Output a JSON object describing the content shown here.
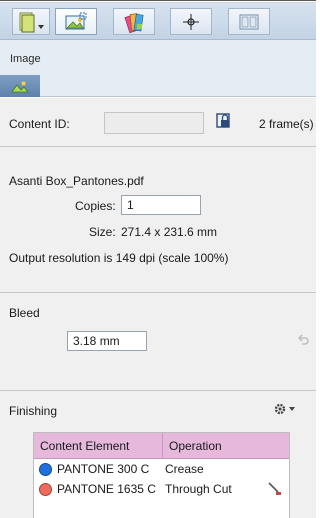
{
  "toolbar": {
    "items": [
      {
        "name": "document-dropdown",
        "icon": "document-dropdown-icon"
      },
      {
        "name": "image",
        "icon": "image-icon"
      },
      {
        "name": "color-swatches",
        "icon": "color-swatches-icon"
      },
      {
        "name": "marks",
        "icon": "crosshair-icon"
      },
      {
        "name": "layout",
        "icon": "layout-icon"
      }
    ],
    "active": "image"
  },
  "tab": {
    "label": "Image",
    "icon": "image-icon"
  },
  "content": {
    "label": "Content ID:",
    "id_value": "",
    "frames": "2 frame(s)",
    "lock_icon": "frame-lock-icon"
  },
  "file": {
    "name": "Asanti Box_Pantones.pdf",
    "copies_label": "Copies:",
    "copies_value": "1",
    "size_label": "Size:",
    "size_value": "271.4 x 231.6 mm",
    "resolution": "Output resolution is 149 dpi (scale 100%)"
  },
  "bleed": {
    "title": "Bleed",
    "value": "3.18 mm",
    "reset_icon": "undo-icon"
  },
  "finishing": {
    "title": "Finishing",
    "settings_icon": "gear-dropdown-icon",
    "columns": [
      "Content Element",
      "Operation"
    ],
    "rows": [
      {
        "element": "PANTONE 300 C",
        "operation": "Crease",
        "color": "#1f6fdc",
        "icon": ""
      },
      {
        "element": "PANTONE 1635 C",
        "operation": "Through Cut",
        "color": "#f06a5a",
        "icon": "knife-icon"
      }
    ]
  },
  "colors": {
    "toolbar": "#c9d8e8",
    "tab_area": "#e4ecf4",
    "panel": "#f0f0f0",
    "table_header": "#e6b8dc"
  }
}
